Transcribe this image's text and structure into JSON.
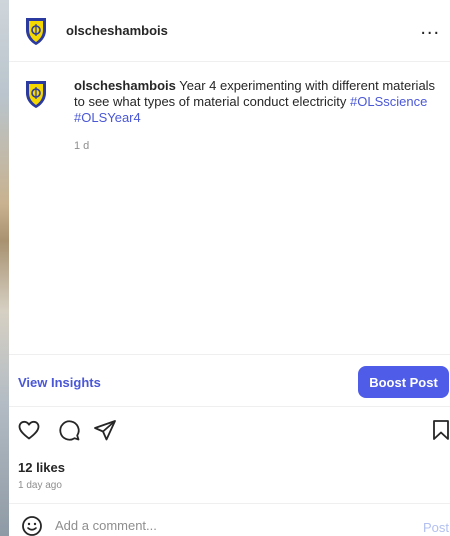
{
  "post": {
    "username": "olscheshambois",
    "more_label": "...",
    "caption": {
      "username": "olscheshambois",
      "text": " Year 4 experimenting with different materials to see what types of material conduct electricity ",
      "tags": [
        "#OLSscience",
        "#OLSYear4"
      ],
      "time": "1 d"
    },
    "insights_label": "View Insights",
    "boost_label": "Boost Post",
    "likes": "12 likes",
    "posted": "1 day ago",
    "comment": {
      "placeholder": "Add a comment...",
      "post_label": "Post"
    }
  },
  "icons": {
    "avatar": "school-crest-icon",
    "like": "heart-icon",
    "comment": "comment-bubble-icon",
    "share": "paper-plane-icon",
    "save": "bookmark-icon",
    "emoji": "smiley-icon",
    "more": "ellipsis-icon"
  },
  "colors": {
    "link": "#4a57d6",
    "button": "#4f5ce8",
    "muted": "#8e8e8e",
    "post_disabled": "#b3c0f0",
    "crest_blue": "#2b3a9e",
    "crest_yellow": "#f5d800"
  }
}
